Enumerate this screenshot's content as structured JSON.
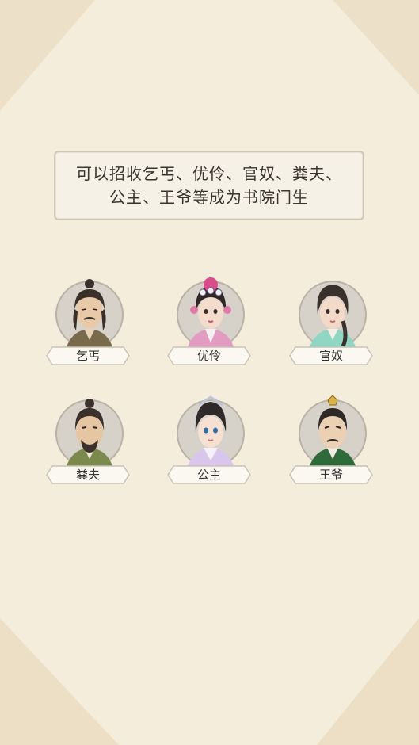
{
  "banner": {
    "line1": "可以招收乞丐、优伶、官奴、粪夫、",
    "line2": "公主、王爷等成为书院门生"
  },
  "characters": [
    {
      "name": "乞丐",
      "icon": "beggar-portrait"
    },
    {
      "name": "优伶",
      "icon": "opera-actress-portrait"
    },
    {
      "name": "官奴",
      "icon": "servant-girl-portrait"
    },
    {
      "name": "粪夫",
      "icon": "night-soil-man-portrait"
    },
    {
      "name": "公主",
      "icon": "princess-portrait"
    },
    {
      "name": "王爷",
      "icon": "prince-portrait"
    }
  ],
  "colors": {
    "background": "#f3ead7",
    "banner_bg": "#f6f1e6",
    "banner_border": "#cfc6b7",
    "text": "#3b3530"
  }
}
